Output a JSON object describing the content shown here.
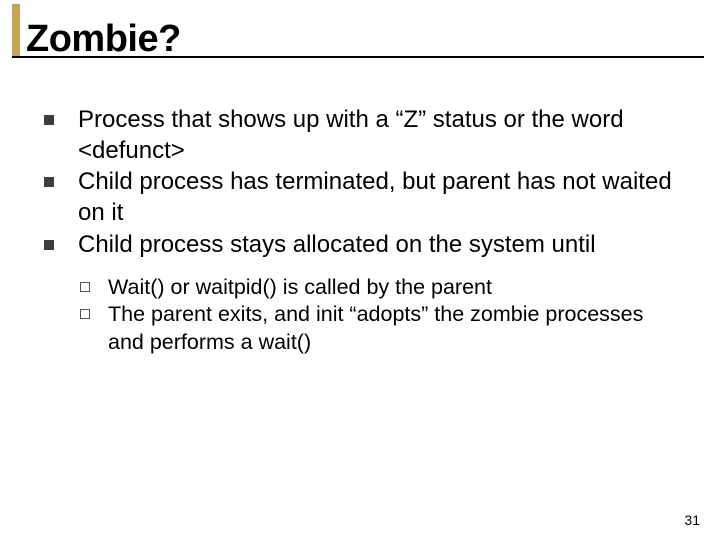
{
  "title": "Zombie?",
  "bullets": [
    "Process that shows up with a “Z” status or the word <defunct>",
    "Child process has terminated, but parent has not waited on it",
    "Child process stays allocated on the system until"
  ],
  "sub_bullets": [
    "Wait() or waitpid() is called by the parent",
    "The parent exits, and init “adopts” the zombie processes and performs a wait()"
  ],
  "page_number": "31"
}
